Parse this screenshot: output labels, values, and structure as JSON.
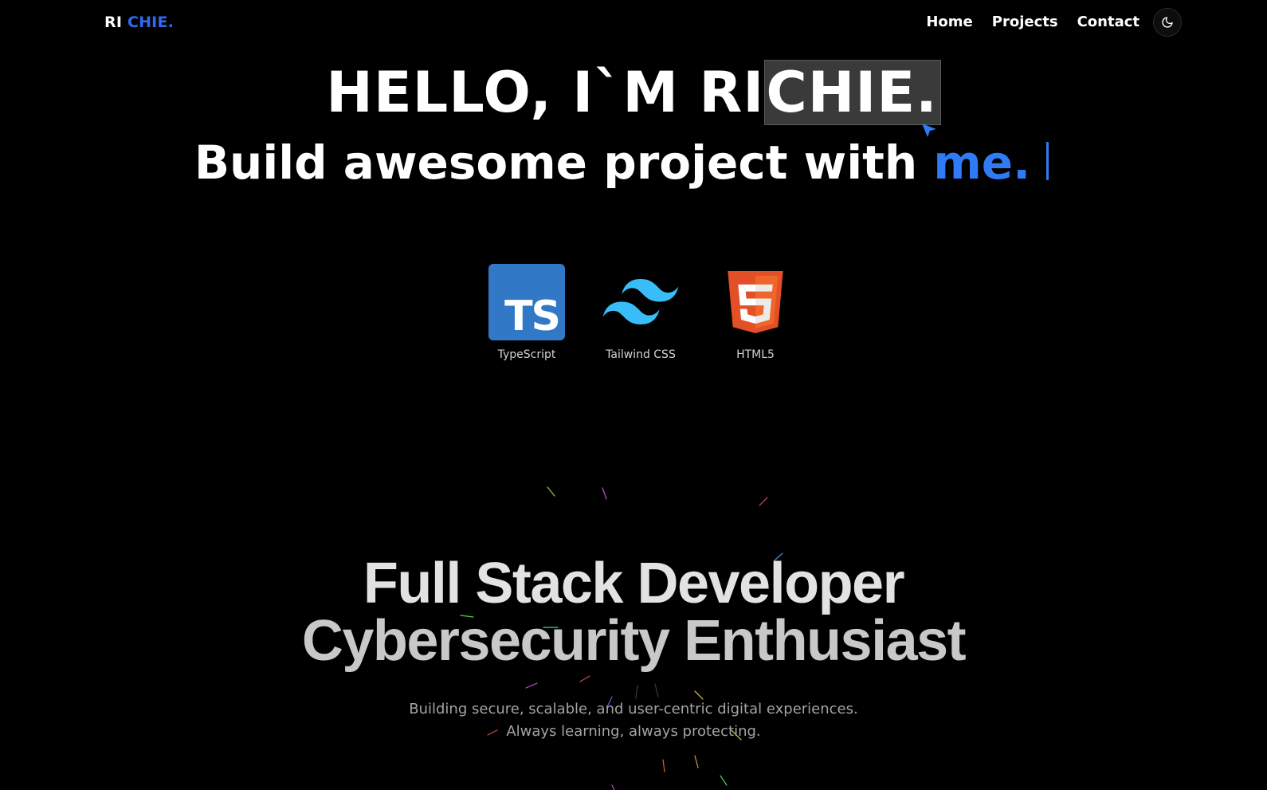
{
  "nav": {
    "logo_part1": "RI",
    "logo_part2": "CHIE.",
    "links": [
      {
        "label": "Home"
      },
      {
        "label": "Projects"
      },
      {
        "label": "Contact"
      }
    ],
    "theme_icon": "moon-icon"
  },
  "hero": {
    "line1_plain": "HELLO, I`M RI",
    "line1_selected": "CHIE.",
    "line2_plain": "Build awesome project with ",
    "line2_accent": "me."
  },
  "tech": [
    {
      "name": "TypeScript",
      "icon": "typescript-icon"
    },
    {
      "name": "Tailwind CSS",
      "icon": "tailwind-icon"
    },
    {
      "name": "HTML5",
      "icon": "html5-icon"
    }
  ],
  "intro": {
    "title_line1": "Full Stack Developer",
    "title_line2": "Cybersecurity Enthusiast",
    "subtitle_line1": "Building secure, scalable, and user-centric digital experiences.",
    "subtitle_line2": "Always learning, always protecting."
  },
  "colors": {
    "background": "#000000",
    "accent": "#2f7bf5",
    "typescript": "#3178c6",
    "tailwind": "#38bdf8",
    "html5": "#e34f26"
  }
}
